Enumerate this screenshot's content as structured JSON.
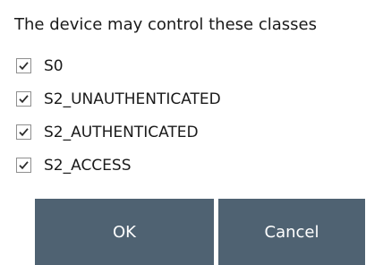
{
  "dialog": {
    "title": "The device may control these classes"
  },
  "classes": [
    {
      "label": "S0",
      "checked": true
    },
    {
      "label": "S2_UNAUTHENTICATED",
      "checked": true
    },
    {
      "label": "S2_AUTHENTICATED",
      "checked": true
    },
    {
      "label": "S2_ACCESS",
      "checked": true
    }
  ],
  "buttons": {
    "ok_label": "OK",
    "cancel_label": "Cancel"
  },
  "colors": {
    "button_background": "#4f6272",
    "button_text": "#ffffff",
    "checkmark": "#2b2b2b",
    "checkbox_border": "#8f8f8f"
  }
}
